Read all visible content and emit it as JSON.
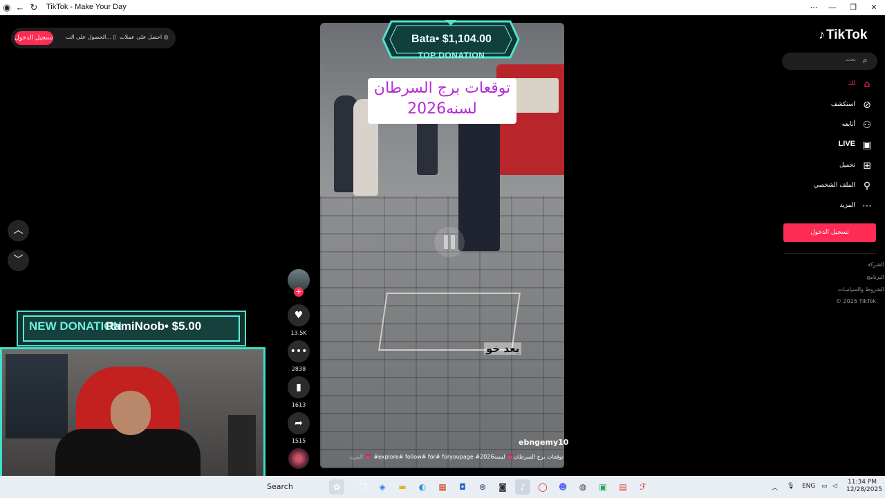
{
  "window": {
    "title": "TikTok - Make Your Day"
  },
  "top_left": {
    "login_label": "تسجيل الدخول",
    "get_app_label": "الحصول على الت...",
    "get_coins_label": "احصل على عملات"
  },
  "video": {
    "caption_line1": "توقعات برج السرطان",
    "caption_line2": "لسنه2026",
    "overlay_text": "يعد خو",
    "watermark": "ebngemy10",
    "description": "توقعات برج السرطان💗 لسنه2026# explore# follow# for# foryoupage# 💗",
    "more_label": "المزيد"
  },
  "top_donation": {
    "name_amount": "Bata• $1,104.00",
    "label": "TOP DONATION"
  },
  "actions": {
    "likes": "13.5K",
    "comments": "2838",
    "saves": "1613",
    "shares": "1515"
  },
  "sidebar": {
    "logo": "TikTok",
    "search_placeholder": "بحث",
    "nav": [
      {
        "label": "لك",
        "icon": "home-icon",
        "active": true
      },
      {
        "label": "استكشف",
        "icon": "compass-icon",
        "active": false
      },
      {
        "label": "أتابعه",
        "icon": "follow-user-icon",
        "active": false
      },
      {
        "label": "LIVE",
        "icon": "live-tv-icon",
        "active": false
      },
      {
        "label": "تحميل",
        "icon": "upload-plus-icon",
        "active": false
      },
      {
        "label": "الملف الشخصي",
        "icon": "profile-icon",
        "active": false
      },
      {
        "label": "المزيد",
        "icon": "more-dots-icon",
        "active": false
      }
    ],
    "login_button": "تسجيل الدخول",
    "footer": [
      "الشركة",
      "البرنامج",
      "الشروط والسياسات",
      "© 2025 TikTok"
    ]
  },
  "stream_overlay": {
    "donation_label": "NEW DONATION",
    "donation_name": "RamiNoob• $5.00"
  },
  "taskbar": {
    "search_label": "Search",
    "lang": "ENG",
    "time": "11:34 PM",
    "date": "12/28/2025"
  },
  "colors": {
    "accent": "#fe2c55",
    "overlay_teal": "#4fe3cf"
  }
}
